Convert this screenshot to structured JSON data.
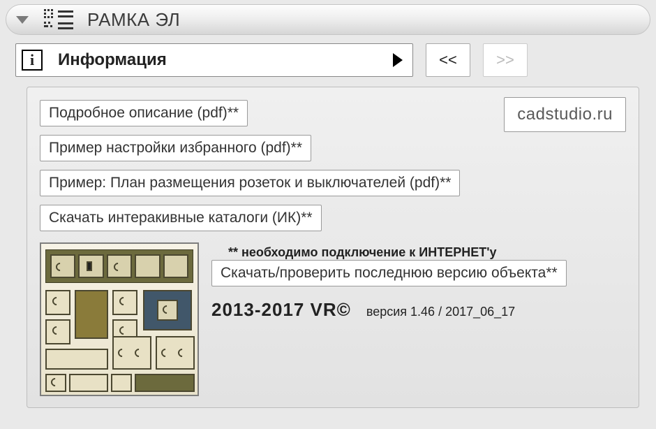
{
  "title": "РАМКА ЭЛ",
  "info_label": "Информация",
  "nav": {
    "prev": "<<",
    "next": ">>"
  },
  "links": {
    "desc": "Подробное описание (pdf)**",
    "fav": "Пример настройки избранного (pdf)**",
    "plan": "Пример: План размещения розеток и выключателей (pdf)**",
    "catalogs": "Скачать интеракивные каталоги (ИК)**",
    "update": "Скачать/проверить последнюю версию объекта**"
  },
  "brand": "cadstudio.ru",
  "note": "** необходимо подключение к ИНТЕРНЕТ'у",
  "credit": {
    "years": "2013-2017  VR©",
    "version": "версия 1.46 / 2017_06_17"
  }
}
